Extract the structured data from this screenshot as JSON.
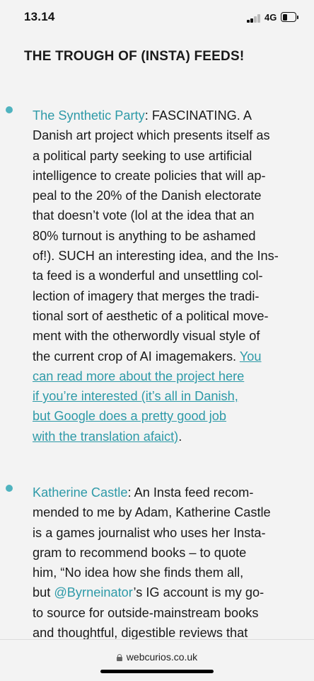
{
  "status_bar": {
    "time": "13.14",
    "network": "4G",
    "battery_percent": 25
  },
  "heading": "THE TROUGH OF (INSTA) FEEDS!",
  "entries": [
    {
      "name": "The Synthetic Party",
      "lines": [
        ": FASCINATING. A",
        "Danish art project which presents itself as",
        "a political party seeking to use artificial",
        "intelligence to create policies that will ap-",
        "peal to the 20% of the Danish electorate",
        "that doesn’t vote (lol at the idea that an",
        "80% turnout is anything to be ashamed",
        "of!). SUCH an interesting idea, and the Ins-",
        "ta feed is a wonderful and unsettling col-",
        "lection of imagery that merges the tradi-",
        "tional sort of aesthetic of a political move-",
        "ment with the otherwordly visual style of",
        "the current crop of AI imagemakers. "
      ],
      "link_lines": [
        "You",
        "can read more about the project here",
        "if you’re interested (it’s all in Danish,",
        "but Google does a pretty good job",
        "with the translation afaict)"
      ],
      "tail": "."
    },
    {
      "name": "Katherine Castle",
      "lines": [
        ": An Insta feed recom-",
        "mended to me by Adam, Katherine Castle",
        "is a games journalist who uses her Insta-",
        "gram to recommend books – to quote",
        "him, “No idea how she finds them all,",
        "but "
      ],
      "handle": "@Byrneinator",
      "lines_after": [
        "’s IG account  is my go-",
        "to source for outside-mainstream books",
        "and thoughtful, digestible reviews that"
      ]
    }
  ],
  "footer": {
    "url": "webcurios.co.uk"
  },
  "colors": {
    "accent": "#2e9aa8",
    "bullet": "#4fb3bf",
    "background": "#f3f3f3"
  }
}
